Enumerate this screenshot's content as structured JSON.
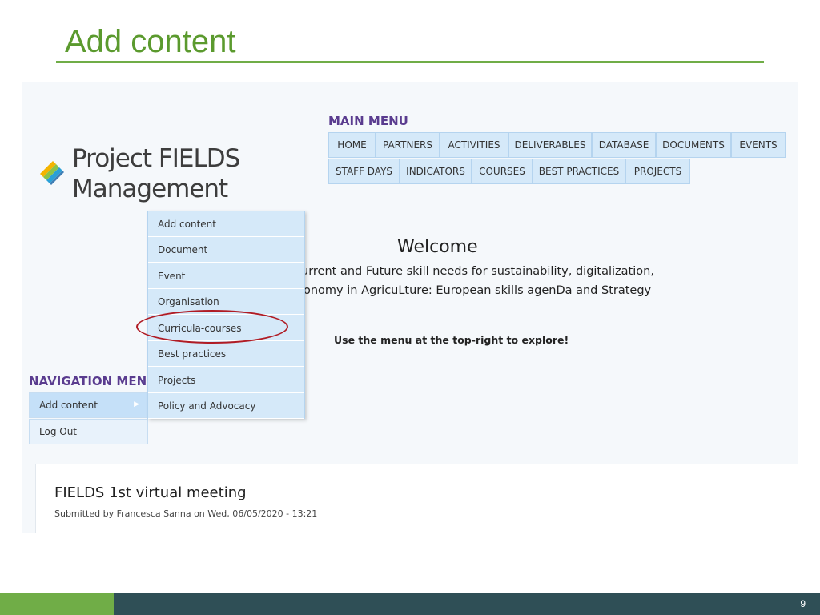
{
  "slide": {
    "title": "Add content",
    "page_number": "9"
  },
  "site": {
    "name_line1": "Project FIELDS",
    "name_line2": "Management",
    "logo_icon": "fields-logo-icon"
  },
  "main_menu": {
    "label": "MAIN MENU",
    "items": [
      "HOME",
      "PARTNERS",
      "ACTIVITIES",
      "DELIVERABLES",
      "DATABASE",
      "DOCUMENTS",
      "EVENTS",
      "STAFF DAYS",
      "INDICATORS",
      "COURSES",
      "BEST PRACTICES",
      "PROJECTS"
    ]
  },
  "welcome": {
    "title": "Welcome",
    "line1": "urrent and Future skill needs for sustainability, digitalization,",
    "line2": "onomy in AgricuLture: European skills agenDa and Strategy",
    "hint": "Use the menu at the top-right to explore!"
  },
  "navigation_menu": {
    "label": "NAVIGATION MENU",
    "items": [
      "Add content",
      "Log Out"
    ],
    "expand_icon": "chevron-right-icon"
  },
  "dropdown": {
    "items": [
      "Add content",
      "Document",
      "Event",
      "Organisation",
      "Curricula-courses",
      "Best practices",
      "Projects",
      "Policy and Advocacy"
    ],
    "highlighted": "Curricula-courses"
  },
  "article": {
    "title": "FIELDS 1st virtual meeting",
    "meta": "Submitted by Francesca Sanna on Wed, 06/05/2020 - 13:21"
  },
  "colors": {
    "title_green": "#5b9a2e",
    "accent_purple": "#5a3c8f",
    "menu_blue": "#d5e9f9",
    "highlight_red": "#b01c25",
    "footer_dark": "#2f4f56"
  }
}
